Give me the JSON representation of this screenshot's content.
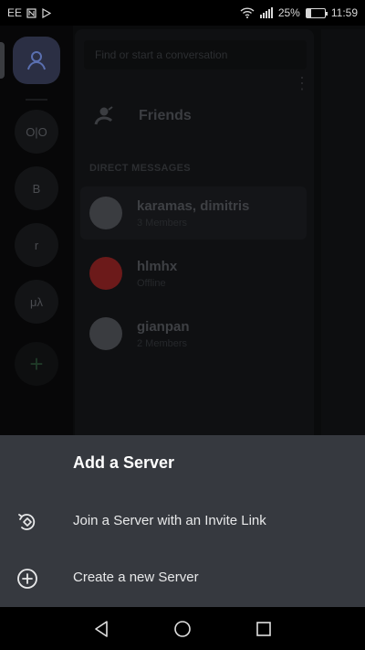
{
  "status_bar": {
    "carrier": "EE",
    "left_icons": [
      "nfc-icon",
      "play-store-icon"
    ],
    "battery_percent": "25%",
    "battery_level": 0.25,
    "time": "11:59"
  },
  "servers": [
    {
      "label": "O|O"
    },
    {
      "label": "B"
    },
    {
      "label": "r"
    },
    {
      "label": "μλ"
    }
  ],
  "add_server_glyph": "+",
  "search": {
    "placeholder": "Find or start a conversation"
  },
  "friends_label": "Friends",
  "dm_header": "DIRECT MESSAGES",
  "dms": [
    {
      "name": "karamas, dimitris",
      "sub": "3 Members"
    },
    {
      "name": "hlmhx",
      "sub": "Offline"
    },
    {
      "name": "gianpan",
      "sub": "2 Members"
    }
  ],
  "sheet": {
    "title": "Add a Server",
    "items": [
      {
        "label": "Join a Server with an Invite Link",
        "icon": "join-link-icon"
      },
      {
        "label": "Create a new Server",
        "icon": "add-circle-icon"
      }
    ]
  },
  "colors": {
    "sheet_bg": "#36393f",
    "text": "#ffffff"
  }
}
